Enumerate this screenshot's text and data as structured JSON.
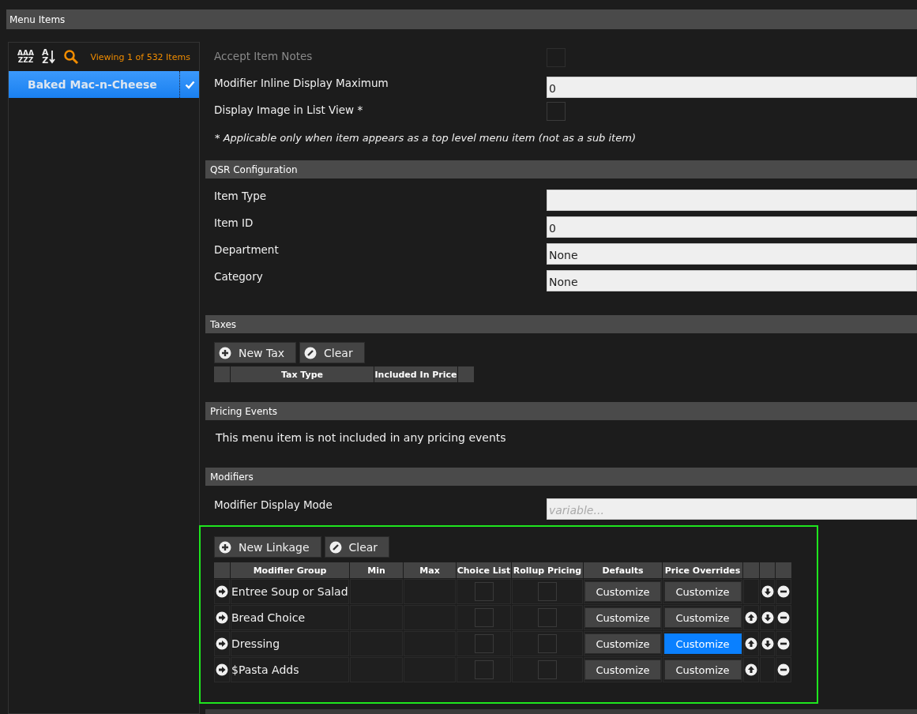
{
  "window": {
    "title": "Menu Items"
  },
  "list_panel": {
    "sort_buttons": [
      {
        "kind": "group",
        "top": "AAA",
        "bottom": "ZZZ"
      },
      {
        "kind": "arrow",
        "top": "A",
        "bottom": "Z"
      }
    ],
    "count": "Viewing 1 of 532 Items",
    "items": [
      {
        "label": "Baked Mac-n-Cheese",
        "selected": true,
        "checked": true
      }
    ]
  },
  "general": {
    "rows": [
      {
        "label": "Accept Item Notes",
        "kind": "checkbox",
        "disabled": true,
        "checked": false
      },
      {
        "label": "Modifier Inline Display Maximum",
        "kind": "input",
        "disabled": false,
        "value": "0"
      },
      {
        "label": "Display Image in List View *",
        "kind": "checkbox",
        "disabled": false,
        "checked": false
      }
    ],
    "note": "* Applicable only when item appears as a top level menu item (not as a sub item)"
  },
  "qsr": {
    "title": "QSR Configuration",
    "rows": [
      {
        "label": "Item Type",
        "kind": "input"
      },
      {
        "label": "Item ID",
        "kind": "input",
        "value": "0"
      },
      {
        "label": "Department",
        "kind": "input",
        "value": "None"
      },
      {
        "label": "Category",
        "kind": "input",
        "value": "None"
      }
    ]
  },
  "taxes": {
    "title": "Taxes",
    "buttons": [
      {
        "kind": "add",
        "label": "New Tax"
      },
      {
        "kind": "clear",
        "label": "Clear"
      }
    ],
    "columns": [
      "Tax Type",
      "Included In Price"
    ]
  },
  "pricing_events": {
    "title": "Pricing Events",
    "message": "This menu item is not included in any pricing events"
  },
  "modifiers": {
    "title": "Modifiers",
    "display_mode": {
      "label": "Modifier Display Mode",
      "placeholder": "variable..."
    },
    "highlighted": true,
    "buttons": [
      {
        "kind": "add",
        "label": "New Linkage"
      },
      {
        "kind": "clear",
        "label": "Clear"
      }
    ],
    "columns": [
      "Modifier Group",
      "Min",
      "Max",
      "Choice List",
      "Rollup Pricing",
      "Defaults",
      "Price Overrides"
    ],
    "rows": [
      {
        "group": "Entree Soup or Salad",
        "choice_list": false,
        "rollup_pricing": false,
        "defaults": {
          "label": "Customize",
          "selected": false
        },
        "overrides": {
          "label": "Customize",
          "selected": false
        },
        "can_move_up": false,
        "can_move_down": true
      },
      {
        "group": "Bread Choice",
        "choice_list": false,
        "rollup_pricing": false,
        "defaults": {
          "label": "Customize",
          "selected": false
        },
        "overrides": {
          "label": "Customize",
          "selected": false
        },
        "can_move_up": true,
        "can_move_down": true
      },
      {
        "group": "Dressing",
        "choice_list": false,
        "rollup_pricing": false,
        "defaults": {
          "label": "Customize",
          "selected": false
        },
        "overrides": {
          "label": "Customize",
          "selected": true
        },
        "can_move_up": true,
        "can_move_down": true
      },
      {
        "group": "$Pasta Adds",
        "choice_list": false,
        "rollup_pricing": false,
        "defaults": {
          "label": "Customize",
          "selected": false
        },
        "overrides": {
          "label": "Customize",
          "selected": false
        },
        "can_move_up": true,
        "can_move_down": false
      }
    ]
  }
}
